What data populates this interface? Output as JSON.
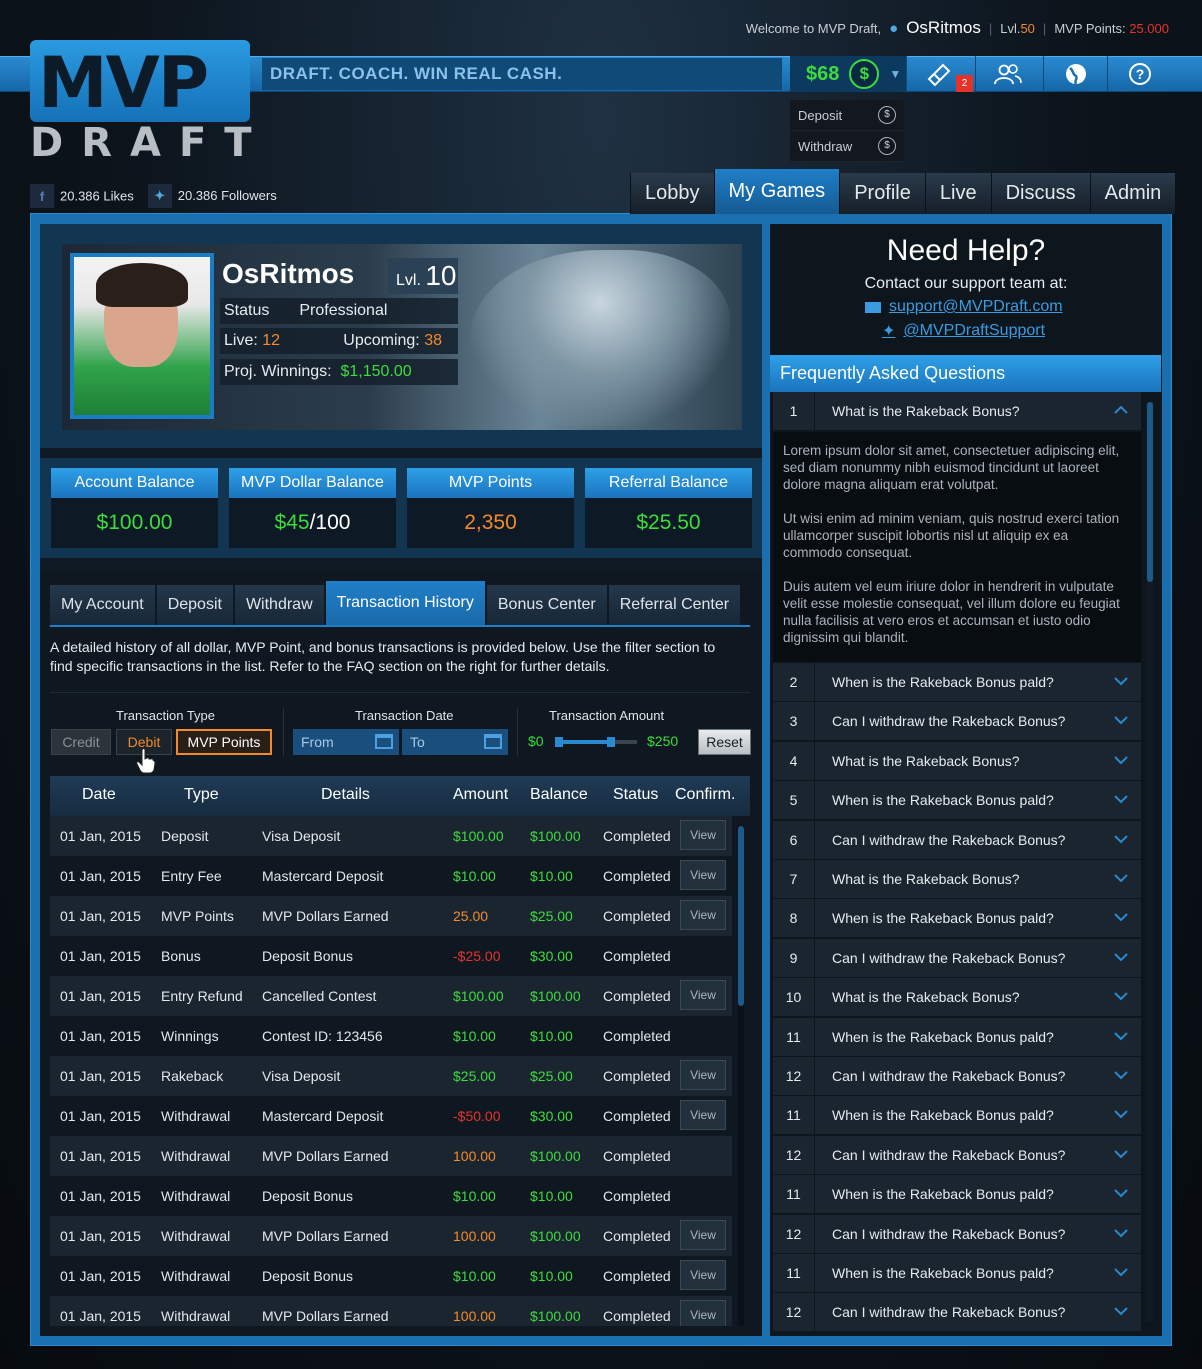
{
  "header": {
    "welcome_prefix": "Welcome to MVP Draft,",
    "username": "OsRitmos",
    "level_label": "Lvl.",
    "level_value": "50",
    "points_label": "MVP Points:",
    "points_value": "25.000",
    "tagline": "DRAFT. COACH. WIN REAL CASH.",
    "logo_top": "MVP",
    "logo_bottom": "DRAFT",
    "dollar_amount": "$68",
    "notification_count": "2",
    "money_menu": [
      {
        "label": "Deposit",
        "icon": "dollar-add-icon"
      },
      {
        "label": "Withdraw",
        "icon": "dollar-remove-icon"
      }
    ]
  },
  "social": {
    "likes": "20.386 Likes",
    "followers": "20.386 Followers"
  },
  "nav": {
    "tabs": [
      "Lobby",
      "My Games",
      "Profile",
      "Live",
      "Discuss",
      "Admin"
    ],
    "active": "My Games"
  },
  "profile": {
    "name": "OsRitmos",
    "lvl_label": "Lvl.",
    "lvl_value": "10",
    "status_label": "Status",
    "status_value": "Professional",
    "live_label": "Live:",
    "live_value": "12",
    "upcoming_label": "Upcoming:",
    "upcoming_value": "38",
    "proj_label": "Proj. Winnings:",
    "proj_value": "$1,150.00"
  },
  "balances": [
    {
      "label": "Account Balance",
      "value": "$100.00"
    },
    {
      "label": "MVP Dollar Balance",
      "value": "$45",
      "suffix": "/100"
    },
    {
      "label": "MVP Points",
      "value": "2,350"
    },
    {
      "label": "Referral Balance",
      "value": "$25.50"
    }
  ],
  "subtabs": {
    "items": [
      "My Account",
      "Deposit",
      "Withdraw",
      "Transaction History",
      "Bonus Center",
      "Referral Center"
    ],
    "active": "Transaction History"
  },
  "description": "A detailed history of all dollar, MVP Point, and bonus transactions is provided below. Use the filter section to find specific transactions in the list. Refer to the FAQ section on the right for further details.",
  "filters": {
    "type_label": "Transaction Type",
    "type_options": [
      "Credit",
      "Debit",
      "MVP Points"
    ],
    "date_label": "Transaction Date",
    "from_placeholder": "From",
    "to_placeholder": "To",
    "amount_label": "Transaction Amount",
    "amount_min": "$0",
    "amount_max": "$250",
    "reset_label": "Reset"
  },
  "table": {
    "columns": [
      "Date",
      "Type",
      "Details",
      "Amount",
      "Balance",
      "Status",
      "Confirm."
    ],
    "view_label": "View",
    "rows": [
      {
        "date": "01 Jan, 2015",
        "type": "Deposit",
        "details": "Visa Deposit",
        "amount": "$100.00",
        "amount_color": "g",
        "balance": "$100.00",
        "status": "Completed",
        "view": true
      },
      {
        "date": "01 Jan, 2015",
        "type": "Entry Fee",
        "details": "Mastercard Deposit",
        "amount": "$10.00",
        "amount_color": "g",
        "balance": "$10.00",
        "status": "Completed",
        "view": true
      },
      {
        "date": "01 Jan, 2015",
        "type": "MVP Points",
        "details": "MVP Dollars Earned",
        "amount": "25.00",
        "amount_color": "o",
        "balance": "$25.00",
        "status": "Completed",
        "view": true
      },
      {
        "date": "01 Jan, 2015",
        "type": "Bonus",
        "details": "Deposit Bonus",
        "amount": "-$25.00",
        "amount_color": "r",
        "balance": "$30.00",
        "status": "Completed",
        "view": false
      },
      {
        "date": "01 Jan, 2015",
        "type": "Entry Refund",
        "details": "Cancelled Contest",
        "amount": "$100.00",
        "amount_color": "g",
        "balance": "$100.00",
        "status": "Completed",
        "view": true
      },
      {
        "date": "01 Jan, 2015",
        "type": "Winnings",
        "details": "Contest ID: 123456",
        "amount": "$10.00",
        "amount_color": "g",
        "balance": "$10.00",
        "status": "Completed",
        "view": false
      },
      {
        "date": "01 Jan, 2015",
        "type": "Rakeback",
        "details": "Visa Deposit",
        "amount": "$25.00",
        "amount_color": "g",
        "balance": "$25.00",
        "status": "Completed",
        "view": true
      },
      {
        "date": "01 Jan, 2015",
        "type": "Withdrawal",
        "details": "Mastercard Deposit",
        "amount": "-$50.00",
        "amount_color": "r",
        "balance": "$30.00",
        "status": "Completed",
        "view": true
      },
      {
        "date": "01 Jan, 2015",
        "type": "Withdrawal",
        "details": "MVP Dollars Earned",
        "amount": "100.00",
        "amount_color": "o",
        "balance": "$100.00",
        "status": "Completed",
        "view": false
      },
      {
        "date": "01 Jan, 2015",
        "type": "Withdrawal",
        "details": "Deposit Bonus",
        "amount": "$10.00",
        "amount_color": "g",
        "balance": "$10.00",
        "status": "Completed",
        "view": false
      },
      {
        "date": "01 Jan, 2015",
        "type": "Withdrawal",
        "details": "MVP Dollars Earned",
        "amount": "100.00",
        "amount_color": "o",
        "balance": "$100.00",
        "status": "Completed",
        "view": true
      },
      {
        "date": "01 Jan, 2015",
        "type": "Withdrawal",
        "details": "Deposit Bonus",
        "amount": "$10.00",
        "amount_color": "g",
        "balance": "$10.00",
        "status": "Completed",
        "view": true
      },
      {
        "date": "01 Jan, 2015",
        "type": "Withdrawal",
        "details": "MVP Dollars Earned",
        "amount": "100.00",
        "amount_color": "o",
        "balance": "$100.00",
        "status": "Completed",
        "view": true
      }
    ]
  },
  "help": {
    "title": "Need Help?",
    "subtitle": "Contact our support team at:",
    "email": "support@MVPDraft.com",
    "twitter": "@MVPDraftSupport"
  },
  "faq": {
    "heading": "Frequently Asked Questions",
    "open_answer": [
      "Lorem ipsum dolor sit amet, consectetuer adipiscing elit, sed diam nonummy nibh euismod tincidunt ut laoreet dolore magna aliquam erat volutpat.",
      "Ut wisi enim ad minim veniam, quis nostrud exerci tation ullamcorper suscipit lobortis nisl ut aliquip ex ea commodo consequat.",
      "Duis autem vel eum iriure dolor in hendrerit in vulputate velit esse molestie consequat, vel illum dolore eu feugiat nulla facilisis at vero eros et accumsan et iusto odio dignissim qui blandit."
    ],
    "items": [
      {
        "n": "1",
        "q": "What is the Rakeback Bonus?"
      },
      {
        "n": "2",
        "q": "When is the Rakeback Bonus pald?"
      },
      {
        "n": "3",
        "q": "Can I withdraw the Rakeback Bonus?"
      },
      {
        "n": "4",
        "q": "What is the Rakeback Bonus?"
      },
      {
        "n": "5",
        "q": "When is the Rakeback Bonus pald?"
      },
      {
        "n": "6",
        "q": "Can I withdraw the Rakeback Bonus?"
      },
      {
        "n": "7",
        "q": "What is the Rakeback Bonus?"
      },
      {
        "n": "8",
        "q": "When is the Rakeback Bonus pald?"
      },
      {
        "n": "9",
        "q": "Can I withdraw the Rakeback Bonus?"
      },
      {
        "n": "10",
        "q": "What is the Rakeback Bonus?"
      },
      {
        "n": "11",
        "q": "When is the Rakeback Bonus pald?"
      },
      {
        "n": "12",
        "q": "Can I withdraw the Rakeback Bonus?"
      },
      {
        "n": "11",
        "q": "When is the Rakeback Bonus pald?"
      },
      {
        "n": "12",
        "q": "Can I withdraw the Rakeback Bonus?"
      },
      {
        "n": "11",
        "q": "When is the Rakeback Bonus pald?"
      },
      {
        "n": "12",
        "q": "Can I withdraw the Rakeback Bonus?"
      },
      {
        "n": "11",
        "q": "When is the Rakeback Bonus pald?"
      },
      {
        "n": "12",
        "q": "Can I withdraw the Rakeback Bonus?"
      }
    ]
  },
  "colors": {
    "accent_blue": "#1f7fc8",
    "green": "#3ddc3d",
    "orange": "#f28a2b",
    "red": "#e6332a"
  }
}
